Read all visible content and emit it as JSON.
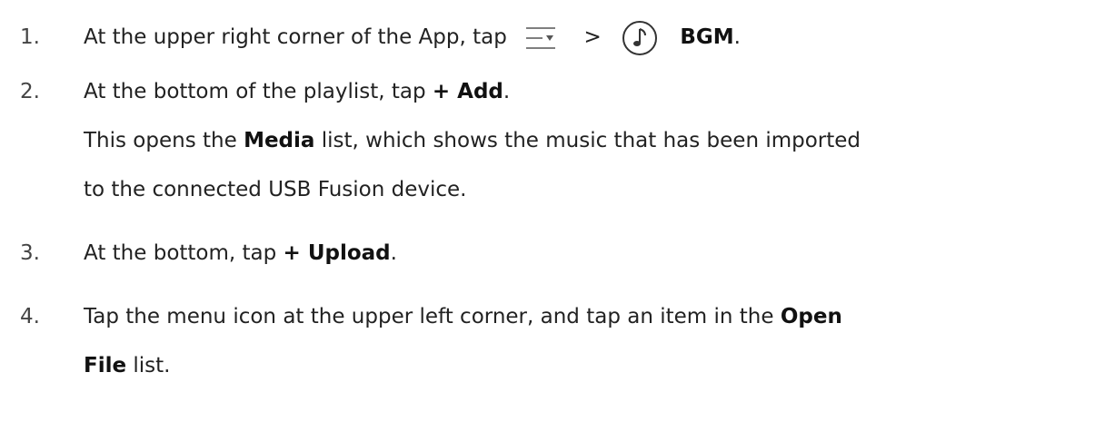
{
  "steps": [
    {
      "num": "1.",
      "text_a": "At the upper right corner of the App, tap",
      "sep": ">",
      "bold_a": "BGM",
      "text_b": "."
    },
    {
      "num": "2.",
      "text_a": "At the bottom of the playlist, tap ",
      "bold_a": "+ Add",
      "text_b": ".",
      "line2_a": "This opens the ",
      "line2_bold": "Media",
      "line2_b": " list, which shows the music that has been imported",
      "line3": "to the connected USB Fusion device."
    },
    {
      "num": "3.",
      "text_a": "At the bottom, tap ",
      "bold_a": "+ Upload",
      "text_b": "."
    },
    {
      "num": "4.",
      "text_a": "Tap the menu icon at the upper left corner, and tap an item in the ",
      "bold_a": "Open",
      "line2_bold": "File",
      "line2_b": " list."
    }
  ],
  "icons": {
    "menu": "menu-dropdown-icon",
    "bgm": "music-note-icon"
  }
}
